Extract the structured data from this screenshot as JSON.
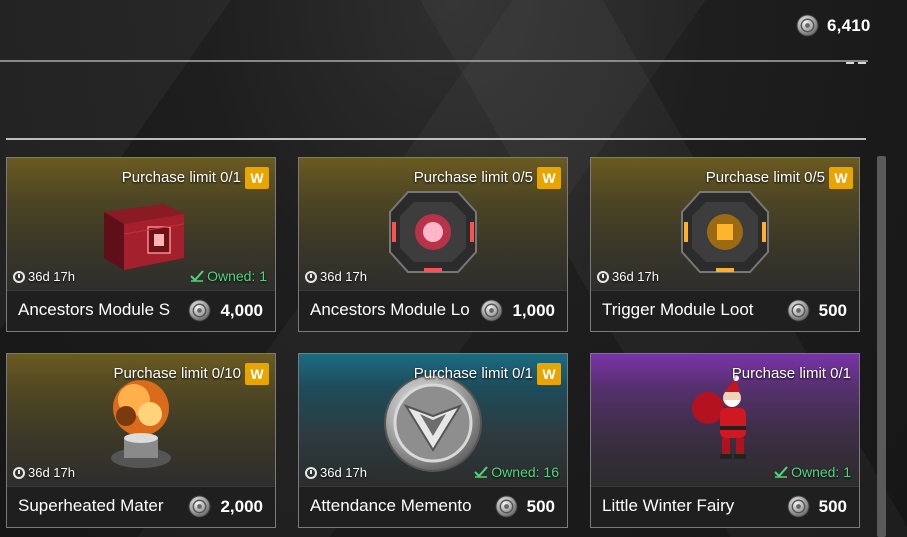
{
  "currency": {
    "icon": "silver-coin-icon",
    "amount": "6,410"
  },
  "colors": {
    "badge": "#e8a500",
    "owned": "#4fd67a",
    "gold_tier": "#6b5a22",
    "teal_tier": "#1c6b84",
    "purple_tier": "#7b33a8"
  },
  "items": [
    {
      "limit": "Purchase limit 0/1",
      "badge": "W",
      "timer": "36d 17h",
      "owned": "Owned: 1",
      "name": "Ancestors Module S",
      "price": "4,000",
      "icon": "red-chest-icon"
    },
    {
      "limit": "Purchase limit 0/5",
      "badge": "W",
      "timer": "36d 17h",
      "owned": "",
      "name": "Ancestors Module Lo",
      "price": "1,000",
      "icon": "red-module-loot-icon"
    },
    {
      "limit": "Purchase limit 0/5",
      "badge": "W",
      "timer": "36d 17h",
      "owned": "",
      "name": "Trigger Module Loot",
      "price": "500",
      "icon": "orange-module-loot-icon"
    },
    {
      "limit": "Purchase limit 0/10",
      "badge": "W",
      "timer": "36d 17h",
      "owned": "",
      "name": "Superheated Mater",
      "price": "2,000",
      "icon": "explosion-material-icon"
    },
    {
      "limit": "Purchase limit 0/1",
      "badge": "W",
      "timer": "36d 17h",
      "owned": "Owned: 16",
      "name": "Attendance Memento",
      "price": "500",
      "icon": "silver-medal-icon"
    },
    {
      "limit": "Purchase limit 0/1",
      "badge": "",
      "timer": "",
      "owned": "Owned: 1",
      "name": "Little Winter Fairy",
      "price": "500",
      "icon": "santa-figure-icon"
    }
  ]
}
